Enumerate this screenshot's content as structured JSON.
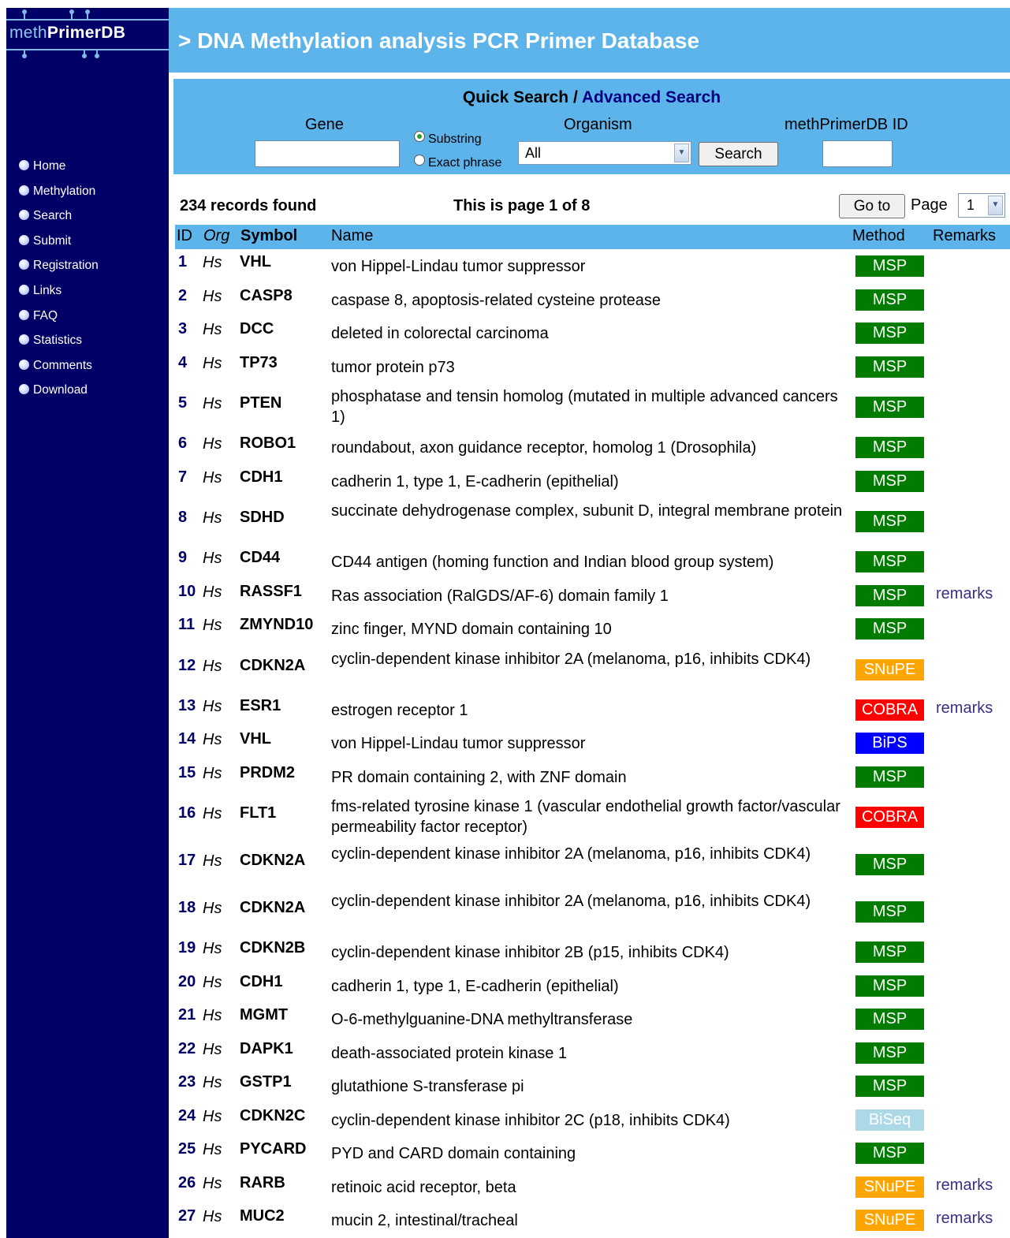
{
  "logo": {
    "prefix": "meth",
    "bold": "PrimerDB"
  },
  "header": {
    "title": "> DNA Methylation analysis PCR Primer Database"
  },
  "nav": [
    "Home",
    "Methylation",
    "Search",
    "Submit",
    "Registration",
    "Links",
    "FAQ",
    "Statistics",
    "Comments",
    "Download"
  ],
  "search": {
    "quick_label": "Quick Search",
    "separator": " / ",
    "advanced_label": "Advanced Search",
    "gene_label": "Gene",
    "gene_value": "",
    "substring_label": "Substring",
    "exact_label": "Exact phrase",
    "match_selected": "Substring",
    "organism_label": "Organism",
    "organism_value": "All",
    "search_button": "Search",
    "id_label": "methPrimerDB ID",
    "id_value": ""
  },
  "results": {
    "count_text": "234 records found",
    "page_text": "This is page 1 of 8",
    "goto_button": "Go to",
    "page_label": "Page",
    "page_value": "1"
  },
  "table": {
    "headers": {
      "id": "ID",
      "org": "Org",
      "symbol": "Symbol",
      "name": "Name",
      "method": "Method",
      "remarks": "Remarks"
    },
    "method_colors": {
      "MSP": "#007d00",
      "SNuPE": "#ffa500",
      "COBRA": "#ff0000",
      "BiPS": "#0000ff",
      "BiSeq": "#add8e6"
    },
    "rows": [
      {
        "id": "1",
        "org": "Hs",
        "symbol": "VHL",
        "name": "von Hippel-Lindau tumor suppressor",
        "method": "MSP",
        "remarks": ""
      },
      {
        "id": "2",
        "org": "Hs",
        "symbol": "CASP8",
        "name": "caspase 8, apoptosis-related cysteine protease",
        "method": "MSP",
        "remarks": ""
      },
      {
        "id": "3",
        "org": "Hs",
        "symbol": "DCC",
        "name": "deleted in colorectal carcinoma",
        "method": "MSP",
        "remarks": ""
      },
      {
        "id": "4",
        "org": "Hs",
        "symbol": "TP73",
        "name": "tumor protein p73",
        "method": "MSP",
        "remarks": ""
      },
      {
        "id": "5",
        "org": "Hs",
        "symbol": "PTEN",
        "name": "phosphatase and tensin homolog (mutated in multiple advanced cancers 1)",
        "method": "MSP",
        "remarks": ""
      },
      {
        "id": "6",
        "org": "Hs",
        "symbol": "ROBO1",
        "name": "roundabout, axon guidance receptor, homolog 1 (Drosophila)",
        "method": "MSP",
        "remarks": ""
      },
      {
        "id": "7",
        "org": "Hs",
        "symbol": "CDH1",
        "name": "cadherin 1, type 1, E-cadherin (epithelial)",
        "method": "MSP",
        "remarks": ""
      },
      {
        "id": "8",
        "org": "Hs",
        "symbol": "SDHD",
        "name": "succinate dehydrogenase complex, subunit D, integral membrane protein",
        "method": "MSP",
        "remarks": ""
      },
      {
        "id": "9",
        "org": "Hs",
        "symbol": "CD44",
        "name": "CD44 antigen (homing function and Indian blood group system)",
        "method": "MSP",
        "remarks": ""
      },
      {
        "id": "10",
        "org": "Hs",
        "symbol": "RASSF1",
        "name": "Ras association (RalGDS/AF-6) domain family 1",
        "method": "MSP",
        "remarks": "remarks"
      },
      {
        "id": "11",
        "org": "Hs",
        "symbol": "ZMYND10",
        "name": "zinc finger, MYND domain containing 10",
        "method": "MSP",
        "remarks": ""
      },
      {
        "id": "12",
        "org": "Hs",
        "symbol": "CDKN2A",
        "name": "cyclin-dependent kinase inhibitor 2A (melanoma, p16, inhibits CDK4)",
        "method": "SNuPE",
        "remarks": ""
      },
      {
        "id": "13",
        "org": "Hs",
        "symbol": "ESR1",
        "name": "estrogen receptor 1",
        "method": "COBRA",
        "remarks": "remarks"
      },
      {
        "id": "14",
        "org": "Hs",
        "symbol": "VHL",
        "name": "von Hippel-Lindau tumor suppressor",
        "method": "BiPS",
        "remarks": ""
      },
      {
        "id": "15",
        "org": "Hs",
        "symbol": "PRDM2",
        "name": "PR domain containing 2, with ZNF domain",
        "method": "MSP",
        "remarks": ""
      },
      {
        "id": "16",
        "org": "Hs",
        "symbol": "FLT1",
        "name": "fms-related tyrosine kinase 1 (vascular endothelial growth factor/vascular permeability factor receptor)",
        "method": "COBRA",
        "remarks": ""
      },
      {
        "id": "17",
        "org": "Hs",
        "symbol": "CDKN2A",
        "name": "cyclin-dependent kinase inhibitor 2A (melanoma, p16, inhibits CDK4)",
        "method": "MSP",
        "remarks": ""
      },
      {
        "id": "18",
        "org": "Hs",
        "symbol": "CDKN2A",
        "name": "cyclin-dependent kinase inhibitor 2A (melanoma, p16, inhibits CDK4)",
        "method": "MSP",
        "remarks": ""
      },
      {
        "id": "19",
        "org": "Hs",
        "symbol": "CDKN2B",
        "name": "cyclin-dependent kinase inhibitor 2B (p15, inhibits CDK4)",
        "method": "MSP",
        "remarks": ""
      },
      {
        "id": "20",
        "org": "Hs",
        "symbol": "CDH1",
        "name": "cadherin 1, type 1, E-cadherin (epithelial)",
        "method": "MSP",
        "remarks": ""
      },
      {
        "id": "21",
        "org": "Hs",
        "symbol": "MGMT",
        "name": "O-6-methylguanine-DNA methyltransferase",
        "method": "MSP",
        "remarks": ""
      },
      {
        "id": "22",
        "org": "Hs",
        "symbol": "DAPK1",
        "name": "death-associated protein kinase 1",
        "method": "MSP",
        "remarks": ""
      },
      {
        "id": "23",
        "org": "Hs",
        "symbol": "GSTP1",
        "name": "glutathione S-transferase pi",
        "method": "MSP",
        "remarks": ""
      },
      {
        "id": "24",
        "org": "Hs",
        "symbol": "CDKN2C",
        "name": "cyclin-dependent kinase inhibitor 2C (p18, inhibits CDK4)",
        "method": "BiSeq",
        "remarks": ""
      },
      {
        "id": "25",
        "org": "Hs",
        "symbol": "PYCARD",
        "name": "PYD and CARD domain containing",
        "method": "MSP",
        "remarks": ""
      },
      {
        "id": "26",
        "org": "Hs",
        "symbol": "RARB",
        "name": "retinoic acid receptor, beta",
        "method": "SNuPE",
        "remarks": "remarks"
      },
      {
        "id": "27",
        "org": "Hs",
        "symbol": "MUC2",
        "name": "mucin 2, intestinal/tracheal",
        "method": "SNuPE",
        "remarks": "remarks"
      }
    ]
  }
}
